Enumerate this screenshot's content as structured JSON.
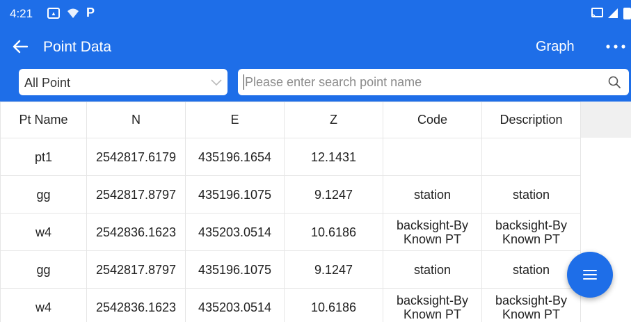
{
  "status_bar": {
    "time": "4:21",
    "notification_letter": "P",
    "icons": [
      "gallery-icon",
      "wifi-icon",
      "parking-icon",
      "cast-icon",
      "signal-icon",
      "battery-icon"
    ]
  },
  "app_bar": {
    "title": "Point Data",
    "graph_label": "Graph",
    "icons": [
      "arrow-left-icon",
      "more-dots-icon"
    ]
  },
  "filter": {
    "selected": "All Point",
    "search_placeholder": "Please enter search point name",
    "search_value": ""
  },
  "table": {
    "columns": [
      "Pt Name",
      "N",
      "E",
      "Z",
      "Code",
      "Description"
    ],
    "rows": [
      {
        "name": "pt1",
        "n": "2542817.6179",
        "e": "435196.1654",
        "z": "12.1431",
        "code": "",
        "description": ""
      },
      {
        "name": "gg",
        "n": "2542817.8797",
        "e": "435196.1075",
        "z": "9.1247",
        "code": "station",
        "description": "station"
      },
      {
        "name": "w4",
        "n": "2542836.1623",
        "e": "435203.0514",
        "z": "10.6186",
        "code": "backsight-By Known PT",
        "description": "backsight-By Known PT"
      },
      {
        "name": "gg",
        "n": "2542817.8797",
        "e": "435196.1075",
        "z": "9.1247",
        "code": "station",
        "description": "station"
      },
      {
        "name": "w4",
        "n": "2542836.1623",
        "e": "435203.0514",
        "z": "10.6186",
        "code": "backsight-By Known PT",
        "description": "backsight-By Known PT"
      }
    ]
  },
  "fab": {
    "icon": "menu-icon"
  },
  "colors": {
    "primary": "#1e6ee8",
    "header_spacer": "#f0f0f0",
    "grid_line": "#e6e6e6"
  }
}
